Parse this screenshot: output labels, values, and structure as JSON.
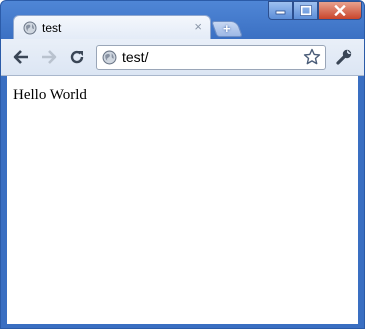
{
  "tab": {
    "title": "test",
    "close_glyph": "×"
  },
  "newtab": {
    "glyph": "+"
  },
  "omnibox": {
    "url": "test/"
  },
  "page": {
    "body_text": "Hello World"
  },
  "icons": {
    "favicon": "globe-icon",
    "back": "back-arrow-icon",
    "forward": "forward-arrow-icon",
    "reload": "reload-icon",
    "star": "star-icon",
    "menu": "wrench-icon",
    "minimize": "minimize-icon",
    "maximize": "maximize-icon",
    "close": "close-icon"
  },
  "colors": {
    "title_bar": "#3a6fc2",
    "close_button": "#c9452c",
    "toolbar": "#dce6f4"
  }
}
